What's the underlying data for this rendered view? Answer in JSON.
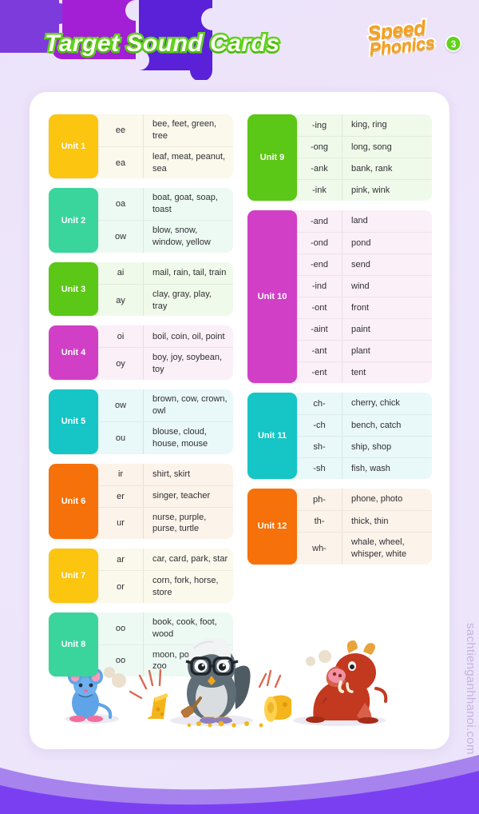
{
  "header": {
    "title": "Target Sound Cards",
    "logo": {
      "line1": "Speed",
      "line2": "Phonics",
      "badge": "3"
    }
  },
  "watermark": "sachtienganhhanoi.com",
  "colors": {
    "unit1": "#FBC510",
    "unit2": "#3AD49D",
    "unit3": "#5BC716",
    "unit4": "#D13FC6",
    "unit5": "#16C5C5",
    "unit6": "#F67109",
    "unit7": "#FBC510",
    "unit8": "#3AD49D",
    "unit9": "#5BC716",
    "unit10": "#D13FC6",
    "unit11": "#16C5C5",
    "unit12": "#F67109",
    "rowYellow": "#FBF8EC",
    "rowGreen": "#EDFAF3",
    "rowLime": "#F0FAEA",
    "rowMagenta": "#FBEFF8",
    "rowTeal": "#E9F8F8",
    "rowOrange": "#FCF3EA",
    "titleFill": "#FBFDF4",
    "titleStroke": "#5FD31A",
    "logoFill": "#F5A01E"
  },
  "columns": {
    "left": [
      {
        "unit": "Unit 1",
        "color": "#FBC510",
        "rowbg": "#FBF8EC",
        "rows": [
          {
            "sound": "ee",
            "words": "bee, feet, green, tree"
          },
          {
            "sound": "ea",
            "words": "leaf, meat, peanut, sea"
          }
        ]
      },
      {
        "unit": "Unit 2",
        "color": "#3AD49D",
        "rowbg": "#EDFAF3",
        "rows": [
          {
            "sound": "oa",
            "words": "boat, goat, soap, toast"
          },
          {
            "sound": "ow",
            "words": "blow, snow, window, yellow"
          }
        ]
      },
      {
        "unit": "Unit 3",
        "color": "#5BC716",
        "rowbg": "#F0FAEA",
        "rows": [
          {
            "sound": "ai",
            "words": "mail, rain, tail, train"
          },
          {
            "sound": "ay",
            "words": "clay, gray, play, tray"
          }
        ]
      },
      {
        "unit": "Unit 4",
        "color": "#D13FC6",
        "rowbg": "#FBEFF8",
        "rows": [
          {
            "sound": "oi",
            "words": "boil, coin, oil, point"
          },
          {
            "sound": "oy",
            "words": "boy, joy, soybean, toy"
          }
        ]
      },
      {
        "unit": "Unit 5",
        "color": "#16C5C5",
        "rowbg": "#E9F8F8",
        "rows": [
          {
            "sound": "ow",
            "words": "brown, cow, crown, owl"
          },
          {
            "sound": "ou",
            "words": "blouse, cloud, house, mouse"
          }
        ]
      },
      {
        "unit": "Unit 6",
        "color": "#F67109",
        "rowbg": "#FCF3EA",
        "rows": [
          {
            "sound": "ir",
            "words": "shirt, skirt"
          },
          {
            "sound": "er",
            "words": "singer, teacher"
          },
          {
            "sound": "ur",
            "words": "nurse, purple, purse, turtle"
          }
        ]
      },
      {
        "unit": "Unit 7",
        "color": "#FBC510",
        "rowbg": "#FBF8EC",
        "rows": [
          {
            "sound": "ar",
            "words": "car, card, park, star"
          },
          {
            "sound": "or",
            "words": "corn, fork, horse, store"
          }
        ]
      },
      {
        "unit": "Unit 8",
        "color": "#3AD49D",
        "rowbg": "#EDFAF3",
        "rows": [
          {
            "sound": "oo",
            "words": "book, cook, foot, wood"
          },
          {
            "sound": "oo",
            "words": "moon, pool, spoon, zoo"
          }
        ]
      }
    ],
    "right": [
      {
        "unit": "Unit 9",
        "color": "#5BC716",
        "rowbg": "#F0FAEA",
        "rows": [
          {
            "sound": "-ing",
            "words": "king, ring"
          },
          {
            "sound": "-ong",
            "words": "long, song"
          },
          {
            "sound": "-ank",
            "words": "bank, rank"
          },
          {
            "sound": "-ink",
            "words": "pink, wink"
          }
        ]
      },
      {
        "unit": "Unit 10",
        "color": "#D13FC6",
        "rowbg": "#FBEFF8",
        "rows": [
          {
            "sound": "-and",
            "words": "land"
          },
          {
            "sound": "-ond",
            "words": "pond"
          },
          {
            "sound": "-end",
            "words": "send"
          },
          {
            "sound": "-ind",
            "words": "wind"
          },
          {
            "sound": "-ont",
            "words": "front"
          },
          {
            "sound": "-aint",
            "words": "paint"
          },
          {
            "sound": "-ant",
            "words": "plant"
          },
          {
            "sound": "-ent",
            "words": "tent"
          }
        ]
      },
      {
        "unit": "Unit 11",
        "color": "#16C5C5",
        "rowbg": "#E9F8F8",
        "rows": [
          {
            "sound": "ch-",
            "words": "cherry, chick"
          },
          {
            "sound": "-ch",
            "words": "bench, catch"
          },
          {
            "sound": "sh-",
            "words": "ship, shop"
          },
          {
            "sound": "-sh",
            "words": "fish, wash"
          }
        ]
      },
      {
        "unit": "Unit 12",
        "color": "#F67109",
        "rowbg": "#FCF3EA",
        "rows": [
          {
            "sound": "ph-",
            "words": "phone, photo"
          },
          {
            "sound": "th-",
            "words": "thick, thin"
          },
          {
            "sound": "wh-",
            "words": "whale, wheel, whisper, white"
          }
        ]
      }
    ]
  },
  "illustration": {
    "characters": [
      "blue-mouse",
      "gray-owl-with-glasses",
      "red-boar"
    ]
  }
}
